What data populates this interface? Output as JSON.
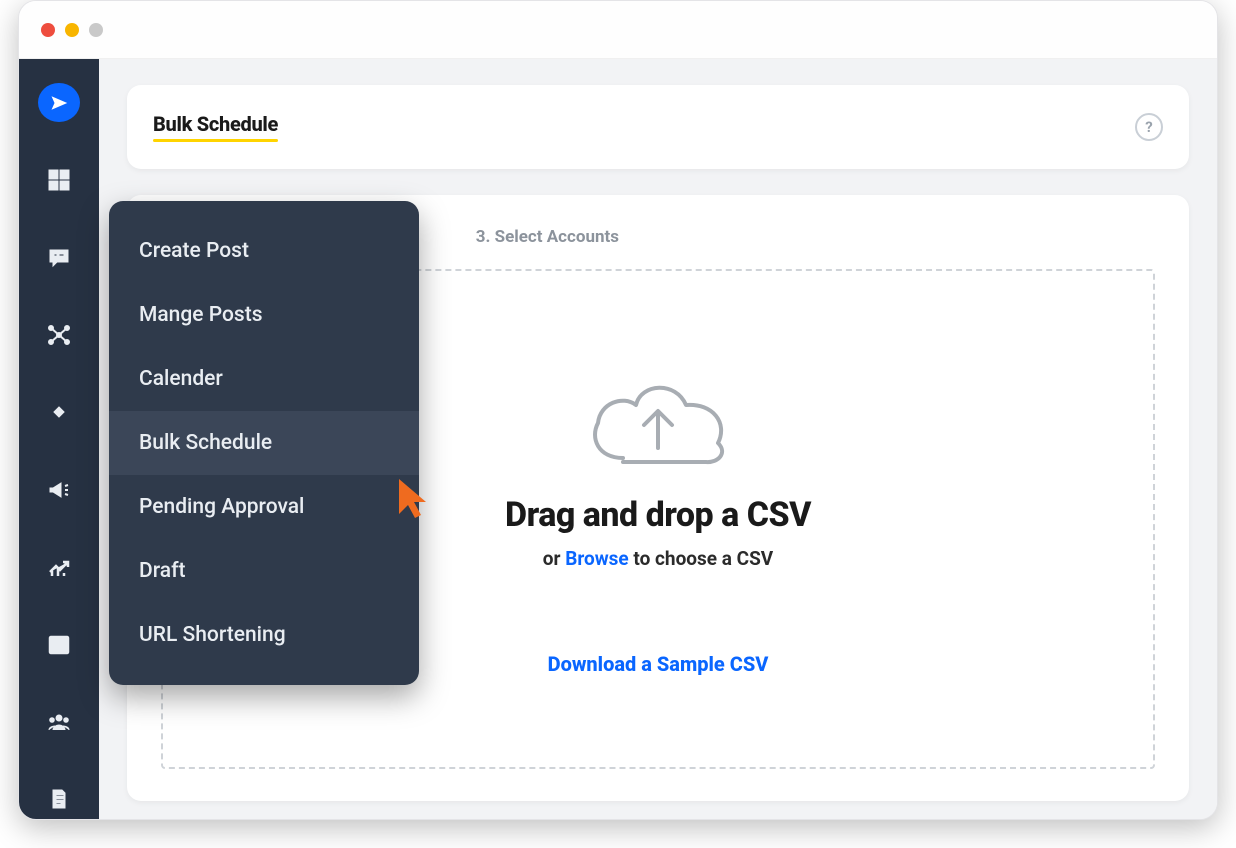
{
  "header": {
    "title": "Bulk Schedule",
    "help": "?"
  },
  "steps": {
    "s3": "3. Select Accounts"
  },
  "drop": {
    "heading": "Drag and drop a CSV",
    "sub_prefix": "or ",
    "sub_browse": "Browse",
    "sub_suffix": " to choose a CSV",
    "sample": "Download a Sample CSV"
  },
  "submenu": {
    "items": [
      {
        "label": "Create Post"
      },
      {
        "label": "Mange Posts"
      },
      {
        "label": "Calender"
      },
      {
        "label": "Bulk Schedule"
      },
      {
        "label": "Pending Approval"
      },
      {
        "label": "Draft"
      },
      {
        "label": "URL Shortening"
      }
    ],
    "activeIndex": 3
  }
}
